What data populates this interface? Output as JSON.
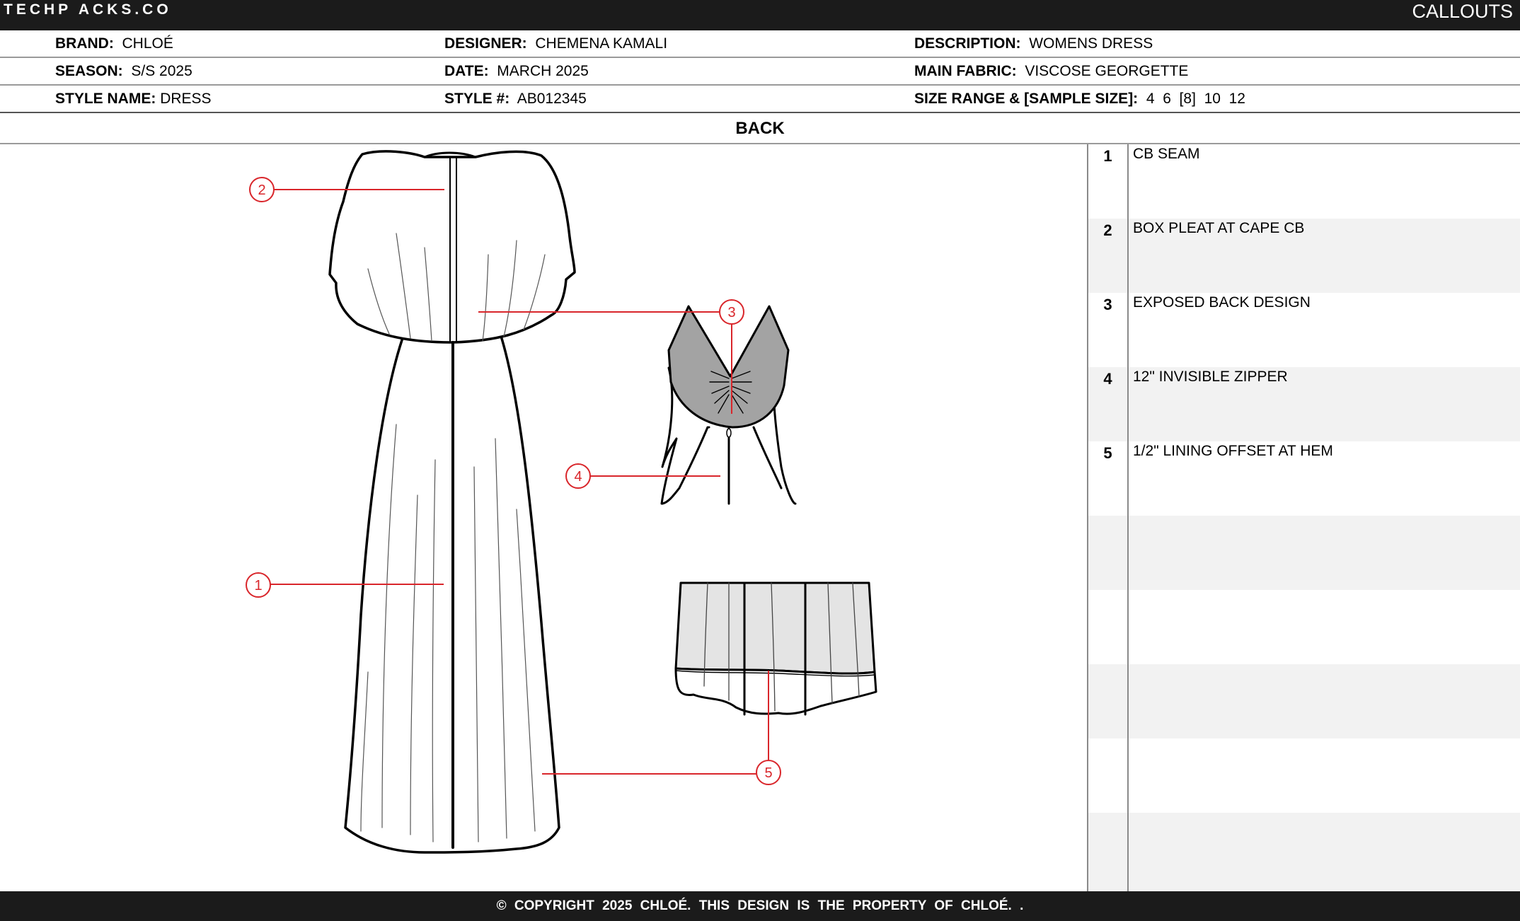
{
  "header": {
    "logo": "TECHP ACKS.CO",
    "section": "CALLOUTS"
  },
  "info": {
    "rows": [
      [
        {
          "label": "BRAND:",
          "value": "CHLOÉ"
        },
        {
          "label": "DESIGNER:",
          "value": "CHEMENA KAMALI"
        },
        {
          "label": "DESCRIPTION:",
          "value": "WOMENS DRESS"
        }
      ],
      [
        {
          "label": "SEASON:",
          "value": "S/S 2025"
        },
        {
          "label": "DATE:",
          "value": "MARCH 2025"
        },
        {
          "label": "MAIN FABRIC:",
          "value": "VISCOSE GEORGETTE"
        }
      ],
      [
        {
          "label": "STYLE NAME:",
          "value": "DRESS"
        },
        {
          "label": "STYLE #:",
          "value": "AB012345"
        },
        {
          "label": "SIZE RANGE & [SAMPLE SIZE]:",
          "value": "4  6  [8]  10  12"
        }
      ]
    ]
  },
  "view_label": "BACK",
  "callouts": [
    {
      "num": "1",
      "text": "CB SEAM"
    },
    {
      "num": "2",
      "text": "BOX PLEAT AT CAPE CB"
    },
    {
      "num": "3",
      "text": "EXPOSED BACK DESIGN"
    },
    {
      "num": "4",
      "text": "12\" INVISIBLE ZIPPER"
    },
    {
      "num": "5",
      "text": "1/2\" LINING OFFSET AT HEM"
    }
  ],
  "markers": [
    "1",
    "2",
    "3",
    "4",
    "5"
  ],
  "footer": {
    "copyright": "© COPYRIGHT 2025 CHLOÉ. THIS DESIGN IS THE PROPERTY OF CHLOÉ. ."
  },
  "colors": {
    "bar": "#1b1b1b",
    "callout_red": "#d9262b",
    "row_alt": "#f2f2f2",
    "back_panel": "#a3a3a3"
  }
}
